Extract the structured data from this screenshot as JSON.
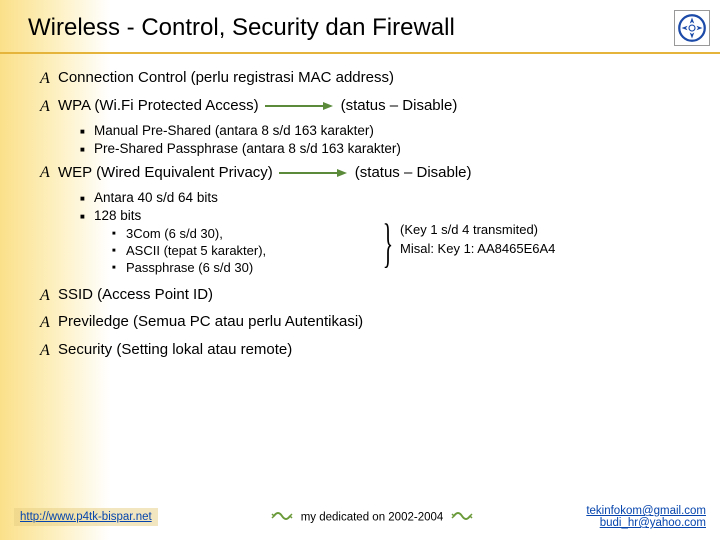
{
  "title": "Wireless - Control, Security dan Firewall",
  "bullets": {
    "b1": "Connection Control (perlu registrasi MAC address)",
    "b2_pre": "WPA (Wi.Fi Protected Access)",
    "b2_post": "(status – Disable)",
    "b2_sub1": "Manual Pre-Shared (antara 8 s/d 163 karakter)",
    "b2_sub2": "Pre-Shared Passphrase (antara 8 s/d 163 karakter)",
    "b3_pre": "WEP (Wired Equivalent Privacy)",
    "b3_post": "(status – Disable)",
    "b3_sub1": "Antara 40 s/d 64 bits",
    "b3_sub2": "128 bits",
    "b3_sub2_a": "3Com (6 s/d 30),",
    "b3_sub2_b": "ASCII (tepat 5 karakter),",
    "b3_sub2_c": "Passphrase (6 s/d 30)",
    "b3_side1": "(Key 1 s/d 4 transmited)",
    "b3_side2": "Misal: Key 1: AA8465E6A4",
    "b4": "SSID (Access Point ID)",
    "b5": "Previledge (Semua PC atau perlu Autentikasi)",
    "b6": "Security (Setting lokal atau remote)"
  },
  "footer": {
    "url": "http://www.p4tk-bispar.net",
    "center": "my dedicated on 2002-2004",
    "email1": "tekinfokom@gmail.com",
    "email2": "budi_hr@yahoo.com"
  }
}
